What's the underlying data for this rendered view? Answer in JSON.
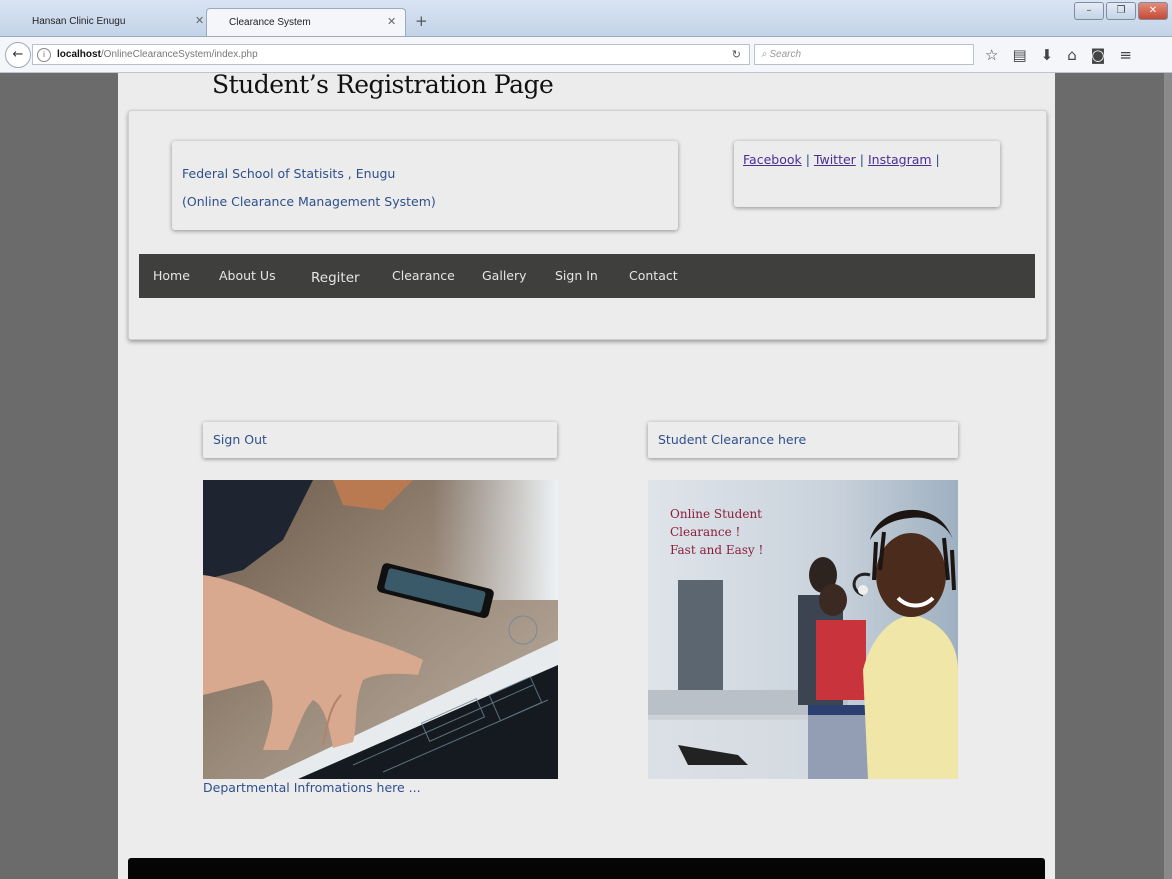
{
  "browser": {
    "tabs": [
      {
        "label": "Hansan Clinic Enugu"
      },
      {
        "label": "Clearance System"
      }
    ],
    "url_host": "localhost",
    "url_path": "/OnlineClearanceSystem/index.php",
    "search_placeholder": "Search"
  },
  "caption": "Student’s Registration Page",
  "header": {
    "school_name": "Federal School of Statisits , Enugu",
    "system_name": "(Online Clearance Management System)",
    "social_links": [
      "Facebook",
      "Twitter",
      "Instagram"
    ]
  },
  "menu": [
    "Home",
    "About Us",
    "Regiter",
    "Clearance",
    "Gallery",
    "Sign In",
    "Contact"
  ],
  "cards": {
    "left_title": "Sign Out",
    "right_title": "Student Clearance here",
    "right_image_text": [
      "Online Student",
      "Clearance !",
      "Fast and Easy !"
    ],
    "dept_text": "Departmental Infromations here ..."
  }
}
